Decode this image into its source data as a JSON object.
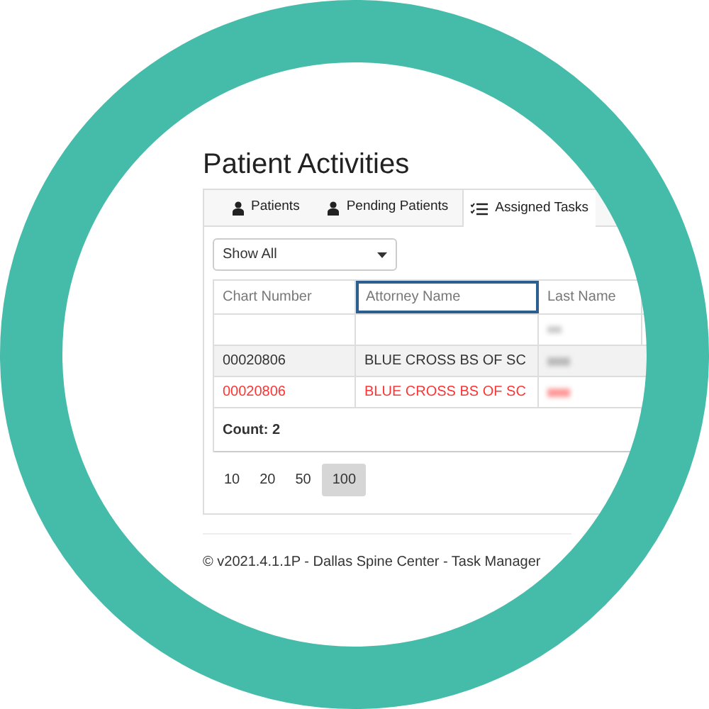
{
  "title": "Patient Activities",
  "tabs": [
    {
      "label": "Patients",
      "kind": "person",
      "selected": false
    },
    {
      "label": "Pending Patients",
      "kind": "person",
      "selected": false
    },
    {
      "label": "Assigned Tasks",
      "kind": "tasks",
      "selected": true
    }
  ],
  "filter_dropdown": {
    "value": "Show All"
  },
  "table": {
    "columns": [
      {
        "label": "Chart Number",
        "focused": false
      },
      {
        "label": "Attorney Name",
        "focused": true
      },
      {
        "label": "Last Name",
        "focused": false
      }
    ],
    "rows": [
      {
        "cells": [
          "00020806",
          "BLUE CROSS BS OF SC"
        ],
        "alert": false
      },
      {
        "cells": [
          "00020806",
          "BLUE CROSS BS OF SC"
        ],
        "alert": true
      }
    ],
    "count": "Count: 2"
  },
  "page_sizes": [
    {
      "label": "10",
      "selected": false
    },
    {
      "label": "20",
      "selected": false
    },
    {
      "label": "50",
      "selected": false
    },
    {
      "label": "100",
      "selected": true
    }
  ],
  "footer": "© v2021.4.1.1P - Dallas Spine Center - Task Manager"
}
